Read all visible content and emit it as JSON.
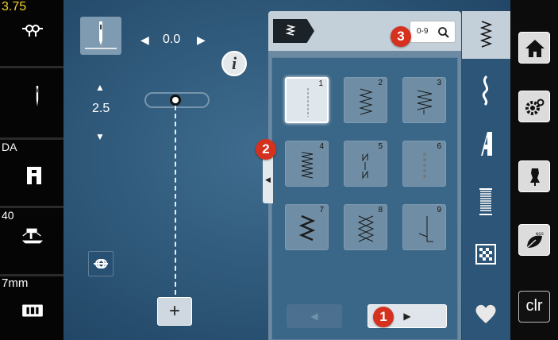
{
  "status": {
    "thread_tension": "3.75",
    "presser_foot": "DA",
    "presser_pressure": "40",
    "stitch_plate": "7mm"
  },
  "needle_position": {
    "value": "0.0"
  },
  "stitch_width": {
    "value": "2.5"
  },
  "stitch_grid": {
    "stitches": [
      {
        "num": "1"
      },
      {
        "num": "2"
      },
      {
        "num": "3"
      },
      {
        "num": "4"
      },
      {
        "num": "5"
      },
      {
        "num": "6"
      },
      {
        "num": "7"
      },
      {
        "num": "8"
      },
      {
        "num": "9"
      }
    ],
    "selected": 1
  },
  "search_button": {
    "label": "0-9"
  },
  "callouts": {
    "one": "1",
    "two": "2",
    "three": "3"
  },
  "right_menu": {
    "clr_label": "clr"
  },
  "info_button": {
    "label": "i"
  },
  "colors": {
    "accent": "#d6311f",
    "panel": "#3a6688",
    "tile": "#cfd8e0"
  }
}
